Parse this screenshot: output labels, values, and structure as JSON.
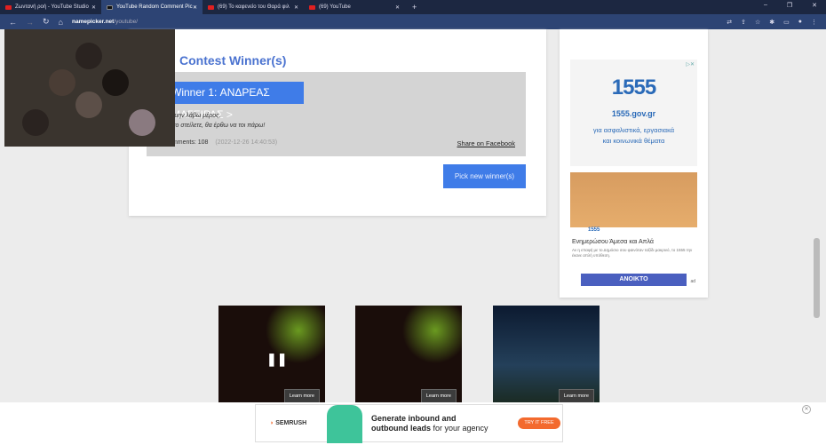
{
  "browser": {
    "tabs": [
      {
        "label": "Ζωντανή ροή - YouTube Studio"
      },
      {
        "label": "YouTube Random Comment Pic"
      },
      {
        "label": "(69) Το καφενείο του Θαρά φιλ"
      },
      {
        "label": "(69) YouTube"
      }
    ],
    "url_host": "namepicker.net",
    "url_path": "/youtube/"
  },
  "main": {
    "title": "Contest Winner(s)",
    "winner": "Winner 1: ΑΝΔΡΕΑΣ ΜΑΓΕΙΡΑΣ >",
    "comment_line1": "Θα μην λάβω μέρος,",
    "comment_line2": "Αν το στείλετε, θα έρθω να τοι πάρω!",
    "comments": "Comments: 108",
    "date": "(2022-12-26 14:40:53)",
    "share": "Share on Facebook",
    "pick": "Pick new winner(s)"
  },
  "sidebar": {
    "ad1": {
      "number": "1555",
      "site": "1555.gov.gr",
      "desc1": "για ασφαλιστικά, εργασιακά",
      "desc2": "και κοινωνικά θέματα"
    },
    "ad2": {
      "logo": "1555",
      "heading": "Ενημερώσου Άμεσα και Απλά",
      "body": "Αν η επαφή με το Δημόσιο σου φαινόταν ταξίδι μακρινό, το 1555 την έκανε απλή υπόθεση.",
      "button": "ΑΝΟΙΚΤΟ",
      "ad": "ad"
    }
  },
  "video_ads": [
    {
      "cta": "Learn more"
    },
    {
      "cta": "Learn more"
    },
    {
      "cta": "Learn more"
    }
  ],
  "banner": {
    "brand": "SEMRUSH",
    "line1": "Generate inbound and",
    "line2_bold": "outbound leads",
    "line2_rest": " for your agency",
    "cta": "TRY IT FREE"
  }
}
